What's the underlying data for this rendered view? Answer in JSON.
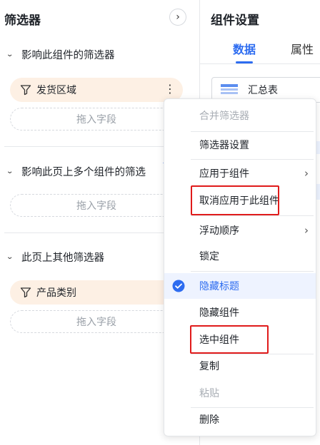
{
  "filter_panel": {
    "title": "筛选器",
    "collapse_icon": "chevron-right-icon",
    "sections": [
      {
        "title": "影响此组件的筛选器",
        "field": {
          "label": "发货区域",
          "icon": "filter-funnel-icon"
        },
        "drop_placeholder": "拖入字段"
      },
      {
        "title": "影响此页上多个组件的筛选",
        "drop_placeholder": "拖入字段"
      },
      {
        "title": "此页上其他筛选器",
        "field": {
          "label": "产品类别",
          "icon": "filter-funnel-icon"
        },
        "drop_placeholder": "拖入字段"
      }
    ]
  },
  "settings_panel": {
    "title": "组件设置",
    "tabs": [
      {
        "label": "数据",
        "active": true
      },
      {
        "label": "属性",
        "active": false
      }
    ],
    "chart_type": {
      "label": "汇总表",
      "icon": "summary-table-icon"
    }
  },
  "context_menu": {
    "items": [
      {
        "label": "合并筛选器",
        "disabled": true
      },
      {
        "label": "筛选器设置"
      },
      {
        "label": "应用于组件",
        "submenu": true
      },
      {
        "label": "取消应用于此组件",
        "highlighted": true
      },
      {
        "label": "浮动顺序",
        "submenu": true
      },
      {
        "label": "锁定"
      },
      {
        "label": "隐藏标题",
        "checked": true
      },
      {
        "label": "隐藏组件"
      },
      {
        "label": "选中组件",
        "highlighted": true
      },
      {
        "label": "复制"
      },
      {
        "label": "粘贴",
        "disabled": true
      },
      {
        "label": "删除"
      }
    ]
  },
  "colors": {
    "accent": "#2d6cf0",
    "pill_bg": "#fdf0e4",
    "highlight_border": "#e01b1b",
    "selected_bg": "#eef3ff"
  }
}
